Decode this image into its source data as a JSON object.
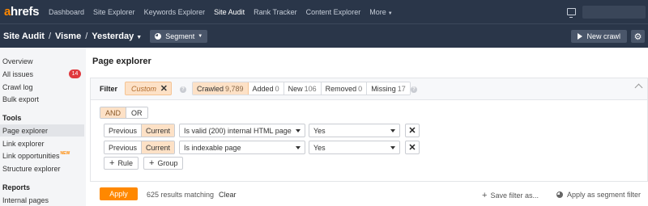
{
  "topnav": {
    "logo_a": "a",
    "logo_rest": "hrefs",
    "items": [
      {
        "label": "Dashboard"
      },
      {
        "label": "Site Explorer"
      },
      {
        "label": "Keywords Explorer"
      },
      {
        "label": "Site Audit",
        "active": true
      },
      {
        "label": "Rank Tracker"
      },
      {
        "label": "Content Explorer"
      },
      {
        "label": "More"
      }
    ],
    "icons": {
      "monitor": "monitor-icon"
    }
  },
  "subbar": {
    "crumb1": "Site Audit",
    "crumb2": "Visme",
    "crumb3": "Yesterday",
    "separator": "/",
    "segment_label": "Segment",
    "new_crawl_label": "New crawl"
  },
  "sidebar": {
    "items": [
      {
        "label": "Overview"
      },
      {
        "label": "All issues",
        "badge": "14"
      },
      {
        "label": "Crawl log"
      },
      {
        "label": "Bulk export"
      }
    ],
    "tools_title": "Tools",
    "tools": [
      {
        "label": "Page explorer",
        "active": true
      },
      {
        "label": "Link explorer"
      },
      {
        "label": "Link opportunities",
        "tag": "NEW"
      },
      {
        "label": "Structure explorer"
      }
    ],
    "reports_title": "Reports",
    "reports": [
      {
        "label": "Internal pages"
      }
    ]
  },
  "main": {
    "title": "Page explorer",
    "filter": {
      "label": "Filter",
      "custom_chip": "Custom",
      "segments": [
        {
          "label": "Crawled",
          "count": "9,789",
          "active": true
        },
        {
          "label": "Added",
          "count": "0"
        },
        {
          "label": "New",
          "count": "106"
        },
        {
          "label": "Removed",
          "count": "0"
        },
        {
          "label": "Missing",
          "count": "17"
        }
      ],
      "logic": {
        "and": "AND",
        "or": "OR",
        "selected": "AND"
      },
      "rules": [
        {
          "previous": "Previous",
          "current": "Current",
          "condition": "Is valid (200) internal HTML page",
          "value": "Yes"
        },
        {
          "previous": "Previous",
          "current": "Current",
          "condition": "Is indexable page",
          "value": "Yes"
        }
      ],
      "add_rule": "Rule",
      "add_group": "Group"
    },
    "footer": {
      "apply": "Apply",
      "results": "625 results matching",
      "clear": "Clear",
      "save_filter": "Save filter as...",
      "apply_segment": "Apply as segment filter"
    }
  },
  "colors": {
    "nav_bg": "#2a3649",
    "accent": "#ff8800",
    "chip_bg": "#fde1c6",
    "badge": "#e0393e"
  }
}
